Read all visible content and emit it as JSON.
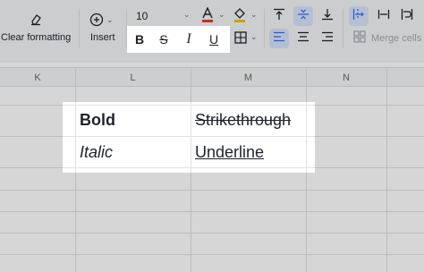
{
  "toolbar": {
    "clear_formatting_label": "Clear formatting",
    "insert_label": "Insert",
    "font_size": "10",
    "merge_cells_label": "Merge cells",
    "format_buttons": {
      "bold": "B",
      "strikethrough": "S",
      "italic": "I",
      "underline": "U"
    }
  },
  "sheet": {
    "columns": [
      "K",
      "L",
      "M",
      "N"
    ],
    "cells": {
      "bold": "Bold",
      "strikethrough": "Strikethrough",
      "italic": "Italic",
      "underline": "Underline"
    }
  },
  "colors": {
    "accent": "#3370ff",
    "text_color_bar": "#e23b3b",
    "fill_color_bar": "#f2c200",
    "highlight": "#d9e4fb"
  }
}
